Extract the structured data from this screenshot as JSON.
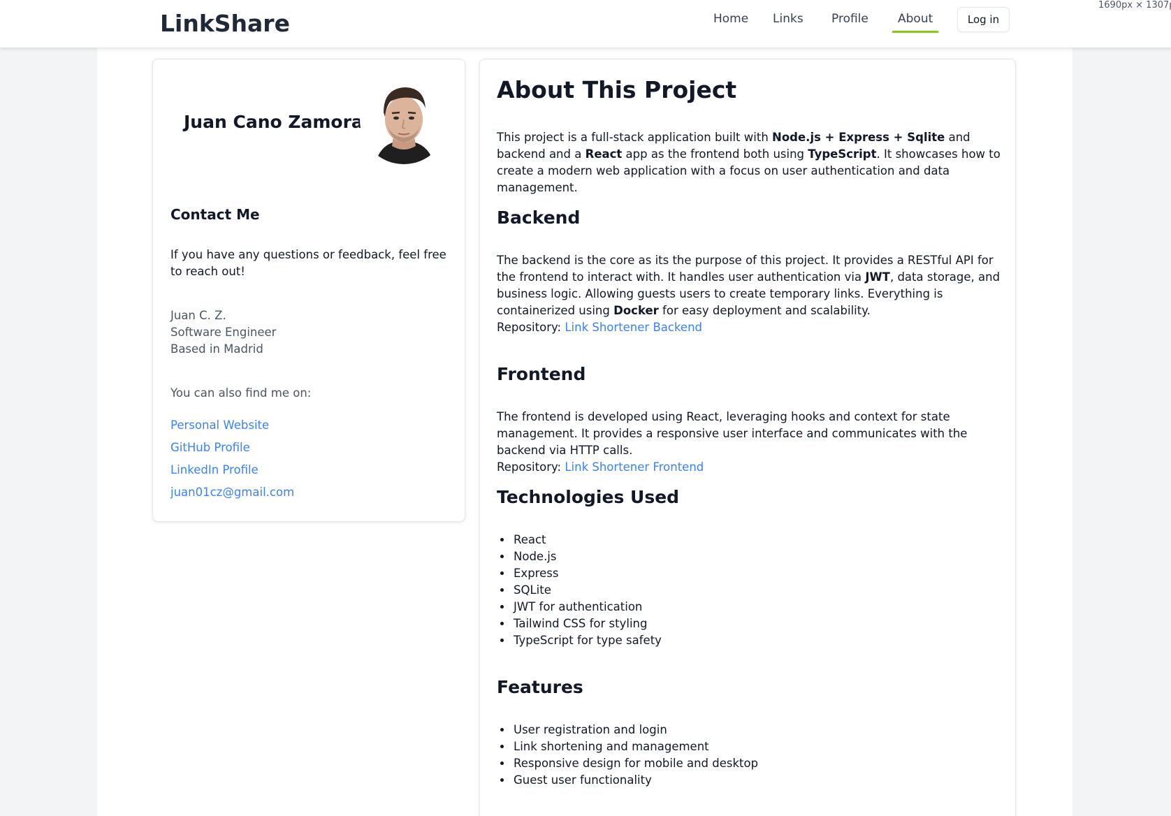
{
  "window": {
    "dimension_readout": "1690px × 1307p"
  },
  "header": {
    "logo": "LinkShare",
    "nav": [
      {
        "label": "Home"
      },
      {
        "label": "Links"
      },
      {
        "label": "Profile"
      },
      {
        "label": "About",
        "active": true
      }
    ],
    "login_label": "Log in",
    "accent_color": "#84cc16"
  },
  "profile": {
    "name": "Juan Cano Zamora",
    "avatar_icon": "avatar-photo",
    "contact_title": "Contact Me",
    "contact_text": "If you have any questions or feedback, feel free to reach out!",
    "info_lines": [
      "Juan C. Z.",
      "Software Engineer",
      "Based in Madrid"
    ],
    "find_me": "You can also find me on:",
    "links": [
      {
        "label": "Personal Website"
      },
      {
        "label": "GitHub Profile"
      },
      {
        "label": "LinkedIn Profile"
      },
      {
        "label": "juan01cz@gmail.com"
      }
    ],
    "link_color": "#3b82f6"
  },
  "about": {
    "title": "About This Project",
    "intro": {
      "p1": "This project is a full-stack application built with ",
      "b1": "Node.js + Express + Sqlite",
      "p2": " and backend and a ",
      "b2": "React",
      "p3": " app as the frontend both using ",
      "b3": "TypeScript",
      "p4": ". It showcases how to create a modern web application with a focus on user authentication and data management."
    },
    "backend": {
      "title": "Backend",
      "p1": "The backend is the core as its the purpose of this project. It provides a RESTful API for the frontend to interact with. It handles user authentication via ",
      "b1": "JWT",
      "p2": ", data storage, and business logic. Allowing guests users to create temporary links. Everything is containerized using ",
      "b2": "Docker",
      "p3": " for easy deployment and scalability.",
      "repo_label": "Repository: ",
      "repo_link": "Link Shortener Backend"
    },
    "frontend": {
      "title": "Frontend",
      "text": "The frontend is developed using React, leveraging hooks and context for state management. It provides a responsive user interface and communicates with the backend via HTTP calls.",
      "repo_label": "Repository: ",
      "repo_link": "Link Shortener Frontend"
    },
    "technologies": {
      "title": "Technologies Used",
      "items": [
        "React",
        "Node.js",
        "Express",
        "SQLite",
        "JWT for authentication",
        "Tailwind CSS for styling",
        "TypeScript for type safety"
      ]
    },
    "features": {
      "title": "Features",
      "items": [
        "User registration and login",
        "Link shortening and management",
        "Responsive design for mobile and desktop",
        "Guest user functionality"
      ]
    }
  }
}
